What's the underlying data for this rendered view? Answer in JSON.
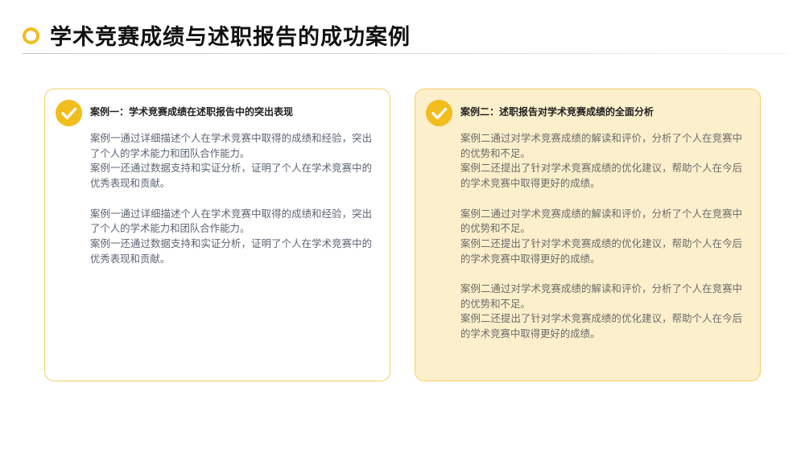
{
  "page": {
    "title": "学术竞赛成绩与述职报告的成功案例"
  },
  "colors": {
    "accent": "#f2bd1d",
    "card_border": "#f4d06a",
    "card2_bg": "#fcefcb",
    "title_text": "#111111"
  },
  "cards": [
    {
      "icon": "check-icon",
      "title": "案例一：学术竞赛成绩在述职报告中的突出表现",
      "blocks": [
        [
          "案例一通过详细描述个人在学术竞赛中取得的成绩和经验，突出了个人的学术能力和团队合作能力。",
          "案例一还通过数据支持和实证分析，证明了个人在学术竞赛中的优秀表现和贡献。"
        ],
        [
          "案例一通过详细描述个人在学术竞赛中取得的成绩和经验，突出了个人的学术能力和团队合作能力。",
          "案例一还通过数据支持和实证分析，证明了个人在学术竞赛中的优秀表现和贡献。"
        ]
      ]
    },
    {
      "icon": "check-icon",
      "title": "案例二：述职报告对学术竞赛成绩的全面分析",
      "blocks": [
        [
          "案例二通过对学术竞赛成绩的解读和评价，分析了个人在竞赛中的优势和不足。",
          "案例二还提出了针对学术竞赛成绩的优化建议，帮助个人在今后的学术竞赛中取得更好的成绩。"
        ],
        [
          "案例二通过对学术竞赛成绩的解读和评价，分析了个人在竞赛中的优势和不足。",
          "案例二还提出了针对学术竞赛成绩的优化建议，帮助个人在今后的学术竞赛中取得更好的成绩。"
        ],
        [
          "案例二通过对学术竞赛成绩的解读和评价，分析了个人在竞赛中的优势和不足。",
          "案例二还提出了针对学术竞赛成绩的优化建议，帮助个人在今后的学术竞赛中取得更好的成绩。"
        ]
      ]
    }
  ]
}
